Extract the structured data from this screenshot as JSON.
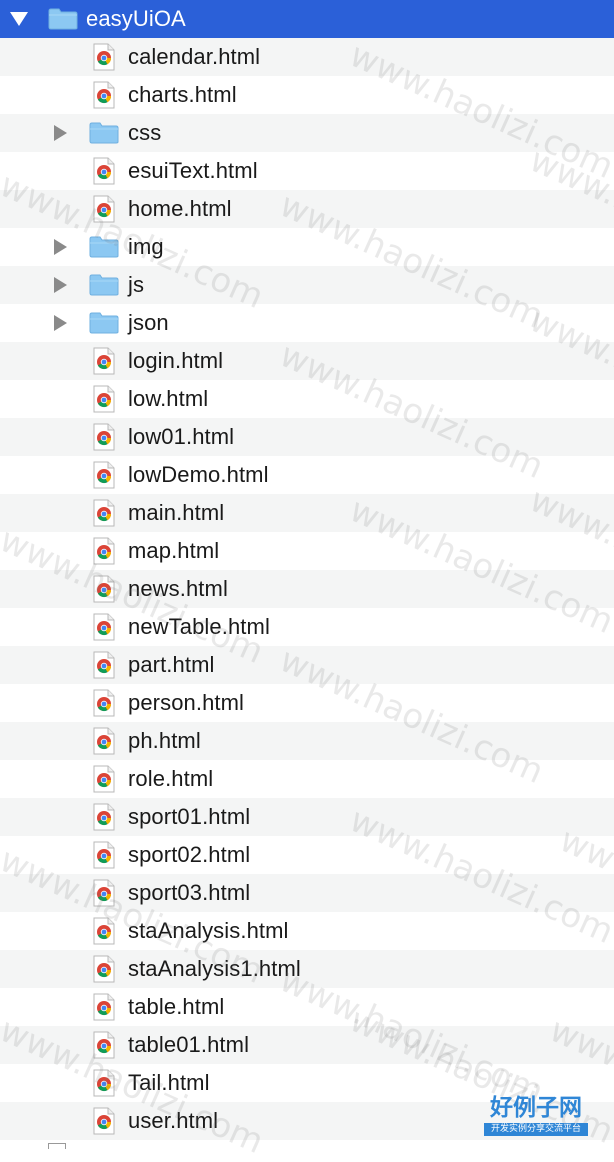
{
  "root": {
    "label": "easyUiOA",
    "expanded": true
  },
  "items": [
    {
      "label": "calendar.html",
      "type": "file"
    },
    {
      "label": "charts.html",
      "type": "file"
    },
    {
      "label": "css",
      "type": "folder"
    },
    {
      "label": "esuiText.html",
      "type": "file"
    },
    {
      "label": "home.html",
      "type": "file"
    },
    {
      "label": "img",
      "type": "folder"
    },
    {
      "label": "js",
      "type": "folder"
    },
    {
      "label": "json",
      "type": "folder"
    },
    {
      "label": "login.html",
      "type": "file"
    },
    {
      "label": "low.html",
      "type": "file"
    },
    {
      "label": "low01.html",
      "type": "file"
    },
    {
      "label": "lowDemo.html",
      "type": "file"
    },
    {
      "label": "main.html",
      "type": "file"
    },
    {
      "label": "map.html",
      "type": "file"
    },
    {
      "label": "news.html",
      "type": "file"
    },
    {
      "label": "newTable.html",
      "type": "file"
    },
    {
      "label": "part.html",
      "type": "file"
    },
    {
      "label": "person.html",
      "type": "file"
    },
    {
      "label": "ph.html",
      "type": "file"
    },
    {
      "label": "role.html",
      "type": "file"
    },
    {
      "label": "sport01.html",
      "type": "file"
    },
    {
      "label": "sport02.html",
      "type": "file"
    },
    {
      "label": "sport03.html",
      "type": "file"
    },
    {
      "label": "staAnalysis.html",
      "type": "file"
    },
    {
      "label": "staAnalysis1.html",
      "type": "file"
    },
    {
      "label": "table.html",
      "type": "file"
    },
    {
      "label": "table01.html",
      "type": "file"
    },
    {
      "label": "Tail.html",
      "type": "file"
    },
    {
      "label": "user.html",
      "type": "file"
    }
  ],
  "watermark": {
    "text": "www.haolizi.com"
  },
  "brand": {
    "title": "好例子网",
    "subtitle": "开发实例分享交流平台"
  },
  "colors": {
    "selection": "#2b60d8",
    "folder": "#8cc8f2",
    "stripe": "#f4f5f5"
  }
}
